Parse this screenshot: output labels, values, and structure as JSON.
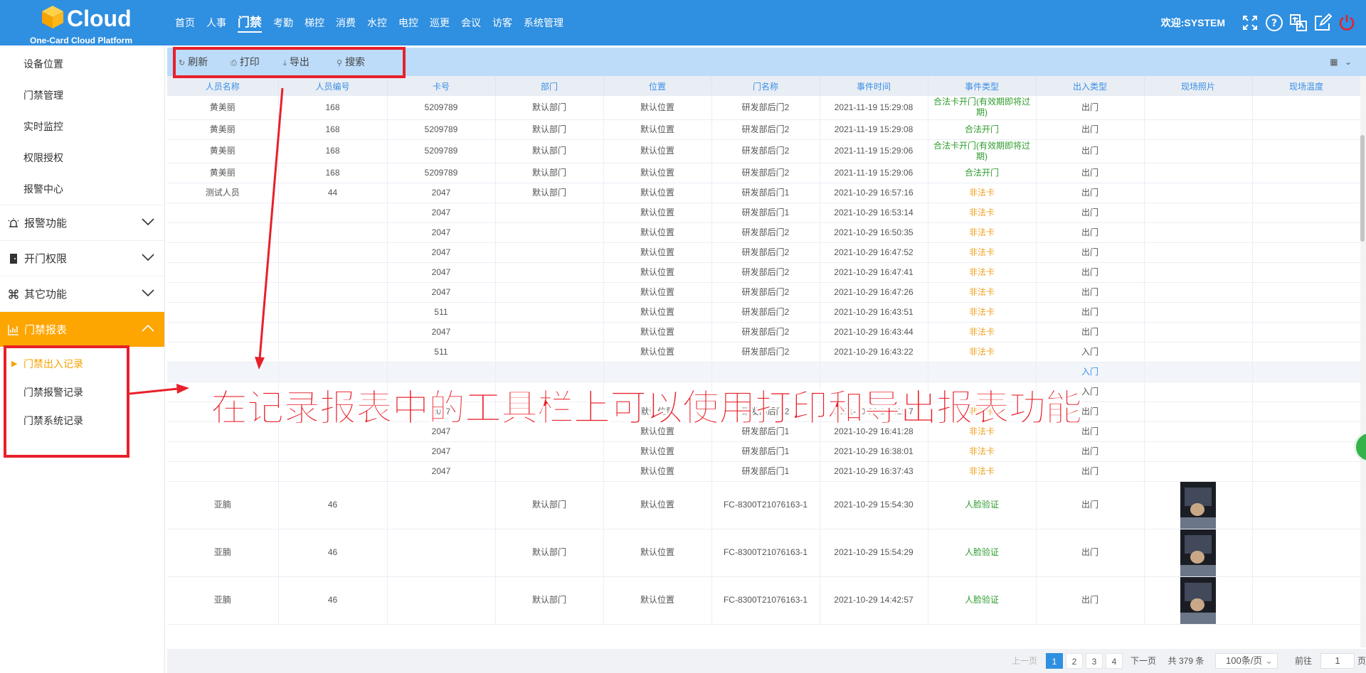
{
  "header": {
    "logo_text": "Cloud",
    "logo_sub": "One-Card Cloud Platform",
    "nav": [
      "首页",
      "人事",
      "门禁",
      "考勤",
      "梯控",
      "消费",
      "水控",
      "电控",
      "巡更",
      "会议",
      "访客",
      "系统管理"
    ],
    "active_nav": "门禁",
    "welcome": "欢迎:SYSTEM",
    "icons": [
      "fullscreen-icon",
      "help-icon",
      "language-icon",
      "edit-icon",
      "power-icon"
    ]
  },
  "sidebar": {
    "sub_items": [
      "设备位置",
      "门禁管理",
      "实时监控",
      "权限授权",
      "报警中心"
    ],
    "groups": [
      {
        "label": "报警功能",
        "icon": "alarm-icon"
      },
      {
        "label": "开门权限",
        "icon": "door-icon"
      },
      {
        "label": "其它功能",
        "icon": "command-icon"
      },
      {
        "label": "门禁报表",
        "icon": "chart-icon"
      }
    ],
    "report_items": [
      "门禁出入记录",
      "门禁报警记录",
      "门禁系统记录"
    ]
  },
  "toolbar": {
    "refresh": "刷新",
    "print": "打印",
    "export": "导出",
    "search": "搜索"
  },
  "table": {
    "columns": [
      "人员名称",
      "人员编号",
      "卡号",
      "部门",
      "位置",
      "门名称",
      "事件时间",
      "事件类型",
      "出入类型",
      "现场照片",
      "现场温度"
    ],
    "rows": [
      {
        "name": "黄美丽",
        "no": "168",
        "card": "5209789",
        "dept": "默认部门",
        "loc": "默认位置",
        "door": "研发部后门2",
        "time": "2021-11-19 15:29:08",
        "event": "合法卡开门(有效期即将过期)",
        "event_color": "green",
        "io": "出门",
        "tall": true
      },
      {
        "name": "黄美丽",
        "no": "168",
        "card": "5209789",
        "dept": "默认部门",
        "loc": "默认位置",
        "door": "研发部后门2",
        "time": "2021-11-19 15:29:08",
        "event": "合法开门",
        "event_color": "green",
        "io": "出门"
      },
      {
        "name": "黄美丽",
        "no": "168",
        "card": "5209789",
        "dept": "默认部门",
        "loc": "默认位置",
        "door": "研发部后门2",
        "time": "2021-11-19 15:29:06",
        "event": "合法卡开门(有效期即将过期)",
        "event_color": "green",
        "io": "出门",
        "tall": true
      },
      {
        "name": "黄美丽",
        "no": "168",
        "card": "5209789",
        "dept": "默认部门",
        "loc": "默认位置",
        "door": "研发部后门2",
        "time": "2021-11-19 15:29:06",
        "event": "合法开门",
        "event_color": "green",
        "io": "出门"
      },
      {
        "name": "测试人员",
        "no": "44",
        "card": "2047",
        "dept": "默认部门",
        "loc": "默认位置",
        "door": "研发部后门1",
        "time": "2021-10-29 16:57:16",
        "event": "非法卡",
        "event_color": "orange",
        "io": "出门"
      },
      {
        "name": "",
        "no": "",
        "card": "2047",
        "dept": "",
        "loc": "默认位置",
        "door": "研发部后门1",
        "time": "2021-10-29 16:53:14",
        "event": "非法卡",
        "event_color": "orange",
        "io": "出门"
      },
      {
        "name": "",
        "no": "",
        "card": "2047",
        "dept": "",
        "loc": "默认位置",
        "door": "研发部后门2",
        "time": "2021-10-29 16:50:35",
        "event": "非法卡",
        "event_color": "orange",
        "io": "出门"
      },
      {
        "name": "",
        "no": "",
        "card": "2047",
        "dept": "",
        "loc": "默认位置",
        "door": "研发部后门2",
        "time": "2021-10-29 16:47:52",
        "event": "非法卡",
        "event_color": "orange",
        "io": "出门"
      },
      {
        "name": "",
        "no": "",
        "card": "2047",
        "dept": "",
        "loc": "默认位置",
        "door": "研发部后门2",
        "time": "2021-10-29 16:47:41",
        "event": "非法卡",
        "event_color": "orange",
        "io": "出门"
      },
      {
        "name": "",
        "no": "",
        "card": "2047",
        "dept": "",
        "loc": "默认位置",
        "door": "研发部后门2",
        "time": "2021-10-29 16:47:26",
        "event": "非法卡",
        "event_color": "orange",
        "io": "出门"
      },
      {
        "name": "",
        "no": "",
        "card": "511",
        "dept": "",
        "loc": "默认位置",
        "door": "研发部后门2",
        "time": "2021-10-29 16:43:51",
        "event": "非法卡",
        "event_color": "orange",
        "io": "出门"
      },
      {
        "name": "",
        "no": "",
        "card": "2047",
        "dept": "",
        "loc": "默认位置",
        "door": "研发部后门2",
        "time": "2021-10-29 16:43:44",
        "event": "非法卡",
        "event_color": "orange",
        "io": "出门"
      },
      {
        "name": "",
        "no": "",
        "card": "511",
        "dept": "",
        "loc": "默认位置",
        "door": "研发部后门2",
        "time": "2021-10-29 16:43:22",
        "event": "非法卡",
        "event_color": "orange",
        "io": "入门"
      },
      {
        "name": "",
        "no": "",
        "card": "",
        "dept": "",
        "loc": "",
        "door": "",
        "time": "",
        "event": "",
        "event_color": "orange",
        "io": "入门",
        "highlight": true,
        "io_blue": true
      },
      {
        "name": "",
        "no": "",
        "card": "",
        "dept": "",
        "loc": "",
        "door": "",
        "time": "",
        "event": "",
        "event_color": "orange",
        "io": "入门"
      },
      {
        "name": "",
        "no": "",
        "card": "2047",
        "dept": "",
        "loc": "默认位置",
        "door": "研发部后门2",
        "time": "2021-10-29 16:41:57",
        "event": "非法卡",
        "event_color": "orange",
        "io": "出门"
      },
      {
        "name": "",
        "no": "",
        "card": "2047",
        "dept": "",
        "loc": "默认位置",
        "door": "研发部后门1",
        "time": "2021-10-29 16:41:28",
        "event": "非法卡",
        "event_color": "orange",
        "io": "出门"
      },
      {
        "name": "",
        "no": "",
        "card": "2047",
        "dept": "",
        "loc": "默认位置",
        "door": "研发部后门1",
        "time": "2021-10-29 16:38:01",
        "event": "非法卡",
        "event_color": "orange",
        "io": "出门"
      },
      {
        "name": "",
        "no": "",
        "card": "2047",
        "dept": "",
        "loc": "默认位置",
        "door": "研发部后门1",
        "time": "2021-10-29 16:37:43",
        "event": "非法卡",
        "event_color": "orange",
        "io": "出门"
      },
      {
        "name": "亚腩",
        "no": "46",
        "card": "",
        "dept": "默认部门",
        "loc": "默认位置",
        "door": "FC-8300T21076163-1",
        "time": "2021-10-29 15:54:30",
        "event": "人脸验证",
        "event_color": "green",
        "io": "出门",
        "photo": true
      },
      {
        "name": "亚腩",
        "no": "46",
        "card": "",
        "dept": "默认部门",
        "loc": "默认位置",
        "door": "FC-8300T21076163-1",
        "time": "2021-10-29 15:54:29",
        "event": "人脸验证",
        "event_color": "green",
        "io": "出门",
        "photo": true
      },
      {
        "name": "亚腩",
        "no": "46",
        "card": "",
        "dept": "默认部门",
        "loc": "默认位置",
        "door": "FC-8300T21076163-1",
        "time": "2021-10-29 14:42:57",
        "event": "人脸验证",
        "event_color": "green",
        "io": "出门",
        "photo": true
      }
    ]
  },
  "pager": {
    "prev": "上一页",
    "pages": [
      "1",
      "2",
      "3",
      "4"
    ],
    "current": "1",
    "next": "下一页",
    "total": "共 379 条",
    "page_size": "100条/页",
    "goto_label": "前往",
    "goto_value": "1",
    "page_unit": "页"
  },
  "annotation": {
    "text": "在记录报表中的工具栏上可以使用打印和导出报表功能"
  }
}
